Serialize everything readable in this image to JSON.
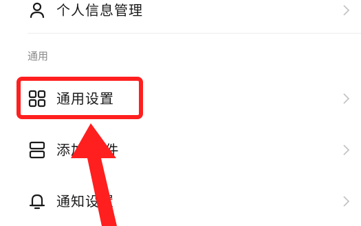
{
  "rows": {
    "profile": {
      "label": "个人信息管理",
      "icon": "person-icon"
    },
    "general": {
      "label": "通用设置",
      "icon": "grid-icon"
    },
    "widget": {
      "label": "添加  组件",
      "icon": "widget-icon"
    },
    "notification": {
      "label": "通知设置",
      "icon": "bell-icon"
    }
  },
  "section": {
    "title": "通用"
  },
  "colors": {
    "annotation": "#ff1f1f",
    "text": "#1a1a1a",
    "secondary_text": "#8a8a8a",
    "chevron": "#c4c4c4"
  }
}
